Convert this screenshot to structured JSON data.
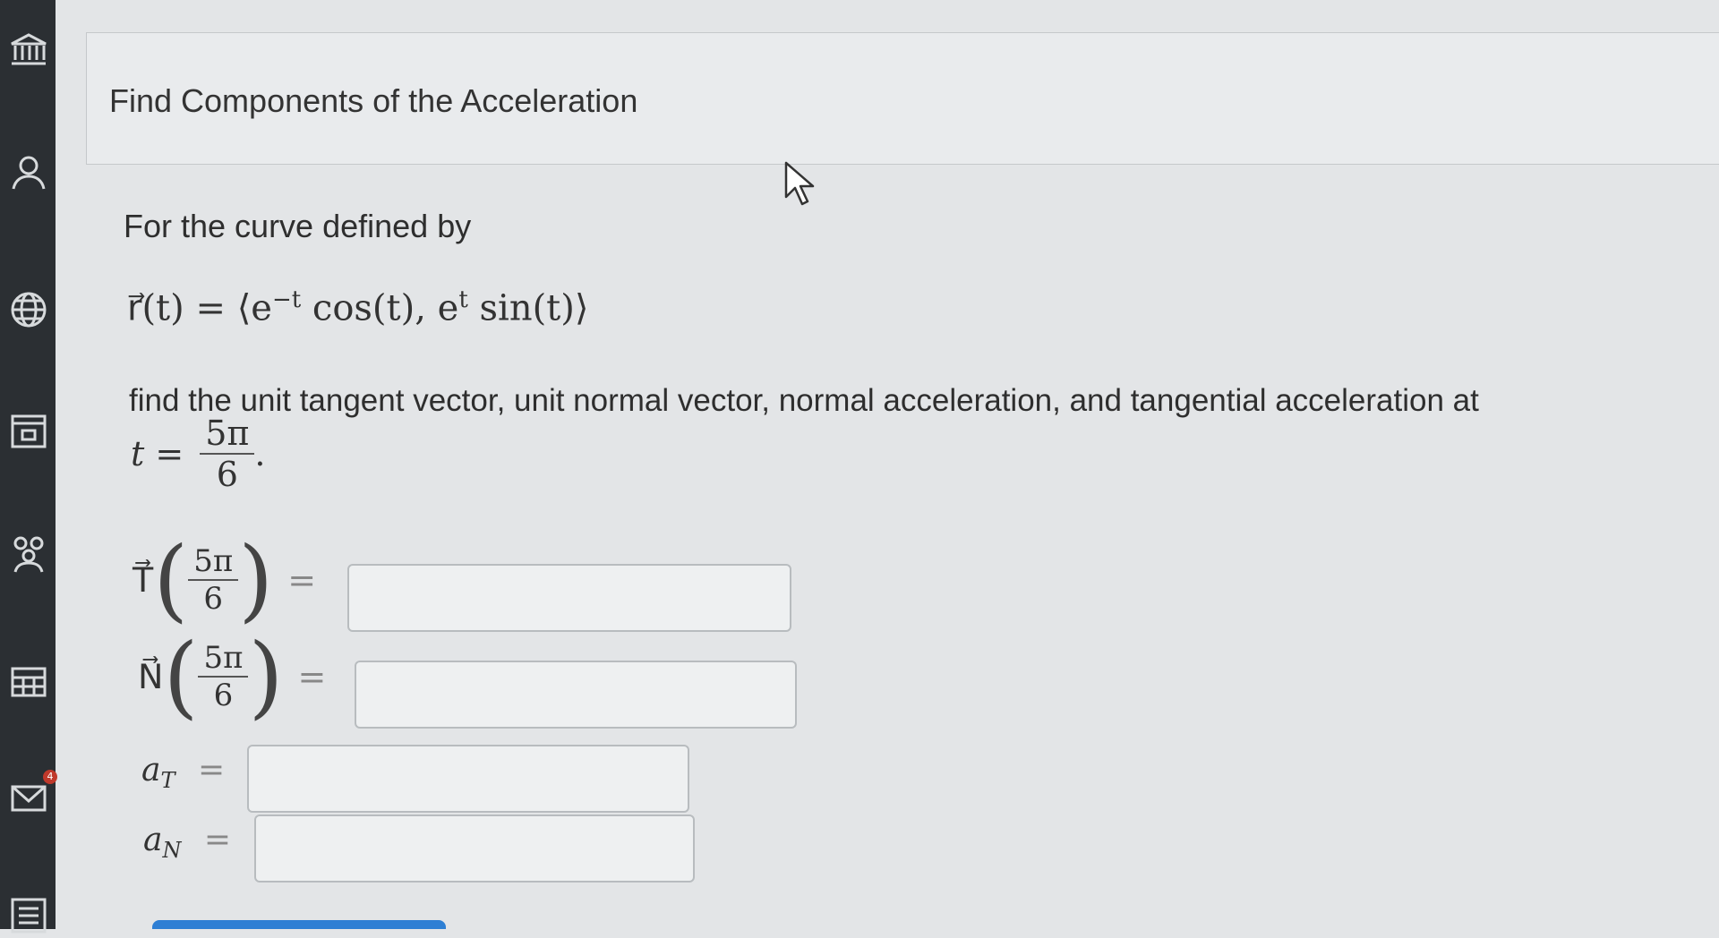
{
  "problem": {
    "title": "Find Components of the Acceleration",
    "intro": "For the curve defined by",
    "curve": {
      "lhs": "r⃗(t) =",
      "rhs": "⟨e",
      "exp1": "−t",
      "mid": " cos(t), e",
      "exp2": "t",
      "tail": " sin(t)⟩"
    },
    "instruction": "find the unit tangent vector, unit normal vector, normal acceleration, and tangential acceleration at",
    "t_label": "t =",
    "t_num": "5π",
    "t_den": "6",
    "t_period": "."
  },
  "answers": {
    "T": {
      "symbol": "T⃗",
      "num": "5π",
      "den": "6",
      "eq": "=",
      "value": ""
    },
    "N": {
      "symbol": "N⃗",
      "num": "5π",
      "den": "6",
      "eq": "=",
      "value": ""
    },
    "aT": {
      "symbol": "a",
      "sub": "T",
      "eq": "=",
      "value": ""
    },
    "aN": {
      "symbol": "a",
      "sub": "N",
      "eq": "=",
      "value": ""
    }
  },
  "sidebar": {
    "icons": [
      "institution-icon",
      "user-icon",
      "globe-icon",
      "calendar-icon",
      "groups-icon",
      "table-icon",
      "mail-icon",
      "list-icon"
    ],
    "mail_badge": "4"
  },
  "colors": {
    "page_bg": "#e3e5e7",
    "sidebar_bg": "#2b2f33",
    "accent": "#2e7fd4"
  }
}
